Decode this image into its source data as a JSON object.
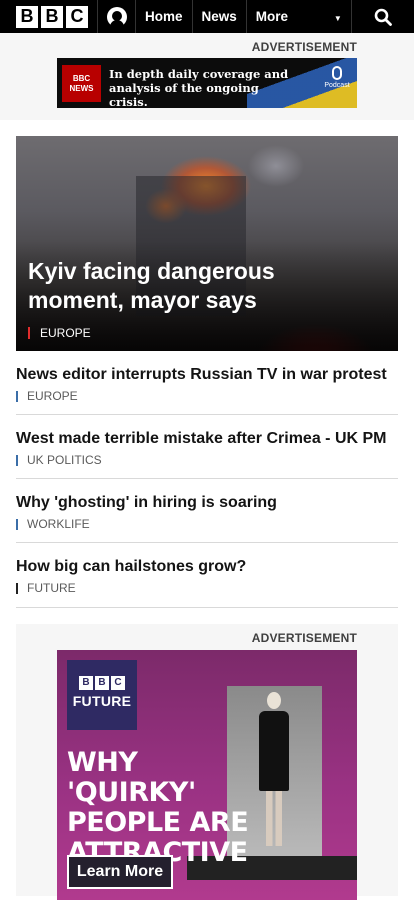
{
  "header": {
    "logo_letters": [
      "B",
      "B",
      "C"
    ],
    "nav": {
      "home": "Home",
      "news": "News",
      "more": "More"
    }
  },
  "ad_top": {
    "label": "ADVERTISEMENT",
    "badge_line1": "BBC",
    "badge_line2": "NEWS",
    "text": "In depth daily coverage and analysis of the ongoing crisis.",
    "podcast": "Podcast"
  },
  "hero": {
    "headline": "Kyiv facing dangerous moment, mayor says",
    "tag": "EUROPE"
  },
  "stories": [
    {
      "headline": "News editor interrupts Russian TV in war protest",
      "tag": "EUROPE"
    },
    {
      "headline": "West made terrible mistake after Crimea - UK PM",
      "tag": "UK POLITICS"
    },
    {
      "headline": "Why 'ghosting' in hiring is soaring",
      "tag": "WORKLIFE"
    },
    {
      "headline": "How big can hailstones grow?",
      "tag": "FUTURE"
    }
  ],
  "ad_bottom": {
    "label": "ADVERTISEMENT",
    "brand_letters": [
      "B",
      "B",
      "C"
    ],
    "brand_name": "FUTURE",
    "headline": "WHY 'QUIRKY' PEOPLE ARE ATTRACTIVE",
    "cta": "Learn More"
  },
  "colors": {
    "topbar": "#000000",
    "tag_hero": "#e02c2c",
    "tag_story": "#3b6ea8",
    "ad_purple": "#9a3283"
  }
}
